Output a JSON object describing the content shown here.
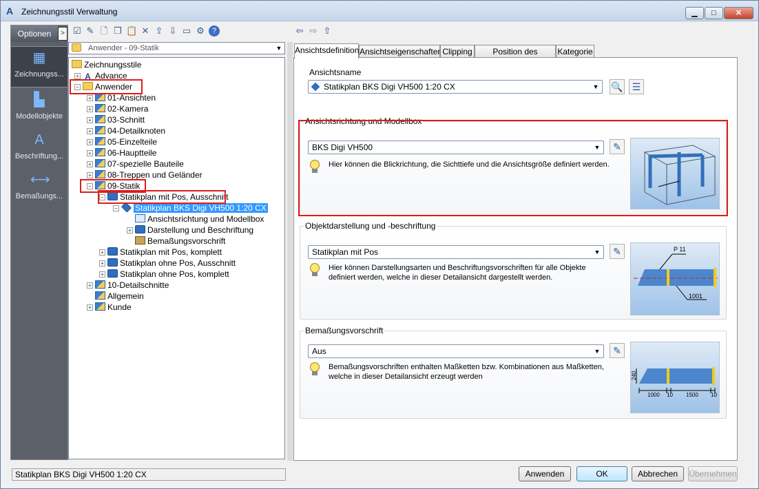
{
  "window": {
    "title": "Zeichnungsstil Verwaltung",
    "app_icon": "A"
  },
  "nav": {
    "options_label": "Optionen",
    "items": [
      {
        "label": "Zeichnungss...",
        "icon": "drawing-style-icon"
      },
      {
        "label": "Modellobjekte",
        "icon": "model-objects-icon"
      },
      {
        "label": "Beschriftung...",
        "icon": "labeling-icon"
      },
      {
        "label": "Bemaßungs...",
        "icon": "dimension-icon"
      }
    ]
  },
  "tree_combo": {
    "value": "Anwender - 09-Statik"
  },
  "tree": {
    "nodes": [
      {
        "label": "Zeichnungsstile"
      },
      {
        "label": "Advance"
      },
      {
        "label": "Anwender"
      },
      {
        "label": "01-Ansichten"
      },
      {
        "label": "02-Kamera"
      },
      {
        "label": "03-Schnitt"
      },
      {
        "label": "04-Detailknoten"
      },
      {
        "label": "05-Einzelteile"
      },
      {
        "label": "06-Hauptteile"
      },
      {
        "label": "07-spezielle Bauteile"
      },
      {
        "label": "08-Treppen und Geländer"
      },
      {
        "label": "09-Statik"
      },
      {
        "label": "Statikplan mit Pos, Ausschnitt"
      },
      {
        "label": "Statikplan BKS Digi VH500 1:20 CX"
      },
      {
        "label": "Ansichtsrichtung und Modellbox"
      },
      {
        "label": "Darstellung und Beschriftung"
      },
      {
        "label": "Bemaßungsvorschrift"
      },
      {
        "label": "Statikplan mit Pos, komplett"
      },
      {
        "label": "Statikplan ohne Pos, Ausschnitt"
      },
      {
        "label": "Statikplan ohne Pos, komplett"
      },
      {
        "label": "10-Detailschnitte"
      },
      {
        "label": "Allgemein"
      },
      {
        "label": "Kunde"
      }
    ]
  },
  "status": {
    "text": "Statikplan BKS Digi VH500 1:20 CX"
  },
  "tabs": [
    {
      "label": "Ansichtsdefinition"
    },
    {
      "label": "Ansichtseigenschaften"
    },
    {
      "label": "Clipping"
    },
    {
      "label": "Position des Nordpfeils"
    },
    {
      "label": "Kategorie"
    }
  ],
  "view_name": {
    "label": "Ansichtsname",
    "value": "Statikplan BKS Digi VH500 1:20 CX"
  },
  "groups": {
    "direction": {
      "title": "Ansichtsrichtung und Modellbox",
      "value": "BKS Digi VH500",
      "desc": "Hier können die Blickrichtung, die Sichttiefe und die Ansichtsgröße definiert werden."
    },
    "object": {
      "title": "Objektdarstellung und -beschriftung",
      "value": "Statikplan mit Pos",
      "desc": "Hier können Darstellungsarten und Beschriftungsvorschriften für alle Objekte definiert werden, welche in dieser Detailansicht dargestellt werden.",
      "preview_labels": {
        "top": "P 11",
        "bottom": "1001"
      }
    },
    "dimension": {
      "title": "Bemaßungsvorschrift",
      "value": "Aus",
      "desc": "Bemaßungsvorschriften enthalten Maßketten bzw. Kombinationen aus Maßketten, welche in dieser Detailansicht erzeugt werden",
      "preview_labels": {
        "left": "240",
        "d1": "1000",
        "d2": "10",
        "d3": "1500",
        "d4": "10"
      }
    }
  },
  "footer": {
    "apply": "Anwenden",
    "ok": "OK",
    "cancel": "Abbrechen",
    "take": "Übernehmen"
  }
}
